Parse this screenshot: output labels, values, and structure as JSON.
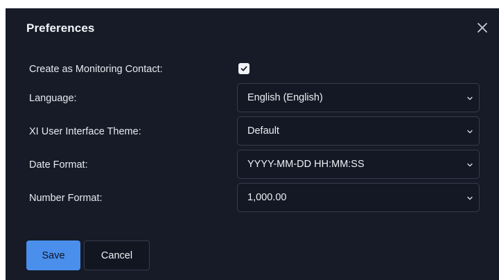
{
  "dialog": {
    "title": "Preferences",
    "close_icon": "close-icon"
  },
  "fields": {
    "monitoring_contact": {
      "label": "Create as Monitoring Contact:",
      "checked": true
    },
    "language": {
      "label": "Language:",
      "value": "English (English)"
    },
    "theme": {
      "label": "XI User Interface Theme:",
      "value": "Default"
    },
    "date_format": {
      "label": "Date Format:",
      "value": "YYYY-MM-DD HH:MM:SS"
    },
    "number_format": {
      "label": "Number Format:",
      "value": "1,000.00"
    }
  },
  "buttons": {
    "save": "Save",
    "cancel": "Cancel"
  },
  "colors": {
    "background": "#161b27",
    "accent": "#4a8fec",
    "border": "#353c4c"
  }
}
